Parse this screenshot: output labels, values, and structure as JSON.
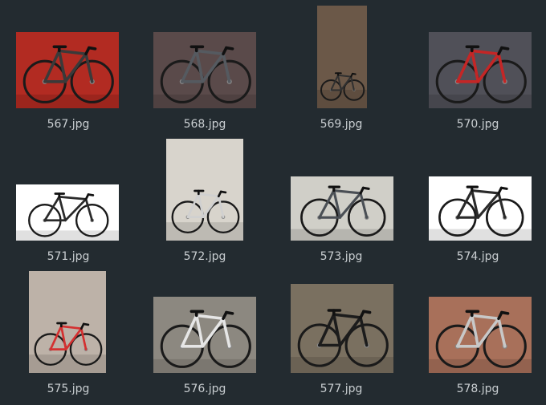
{
  "files": [
    {
      "name": "567.jpg",
      "thumb": "red-wall-bike-icon",
      "bg": "#b22b22",
      "frame": "#3a3a3a"
    },
    {
      "name": "568.jpg",
      "thumb": "grey-roadbike-icon",
      "bg": "#5a4a4a",
      "frame": "#555a60"
    },
    {
      "name": "569.jpg",
      "thumb": "vertical-roadbike-icon",
      "bg": "#6b5848",
      "frame": "#303030"
    },
    {
      "name": "570.jpg",
      "thumb": "red-classic-roadbike-icon",
      "bg": "#505058",
      "frame": "#c42626"
    },
    {
      "name": "571.jpg",
      "thumb": "black-hybrid-bike-icon",
      "bg": "#ffffff",
      "frame": "#2a2a2a"
    },
    {
      "name": "572.jpg",
      "thumb": "white-gravel-bike-icon",
      "bg": "#d8d4cc",
      "frame": "#d0d0d0"
    },
    {
      "name": "573.jpg",
      "thumb": "dark-commuter-bike-icon",
      "bg": "#d0cfc8",
      "frame": "#4a4f55"
    },
    {
      "name": "574.jpg",
      "thumb": "black-endurance-bike-icon",
      "bg": "#ffffff",
      "frame": "#2a2a2a"
    },
    {
      "name": "575.jpg",
      "thumb": "red-white-roadbike-icon",
      "bg": "#bdb2a8",
      "frame": "#d43030"
    },
    {
      "name": "576.jpg",
      "thumb": "white-yard-bike-icon",
      "bg": "#8c8880",
      "frame": "#e6e6e6"
    },
    {
      "name": "577.jpg",
      "thumb": "black-ebike-icon",
      "bg": "#7a7060",
      "frame": "#1c1c1c"
    },
    {
      "name": "578.jpg",
      "thumb": "silver-gravel-bike-icon",
      "bg": "#a8705a",
      "frame": "#c8c8c8"
    }
  ]
}
